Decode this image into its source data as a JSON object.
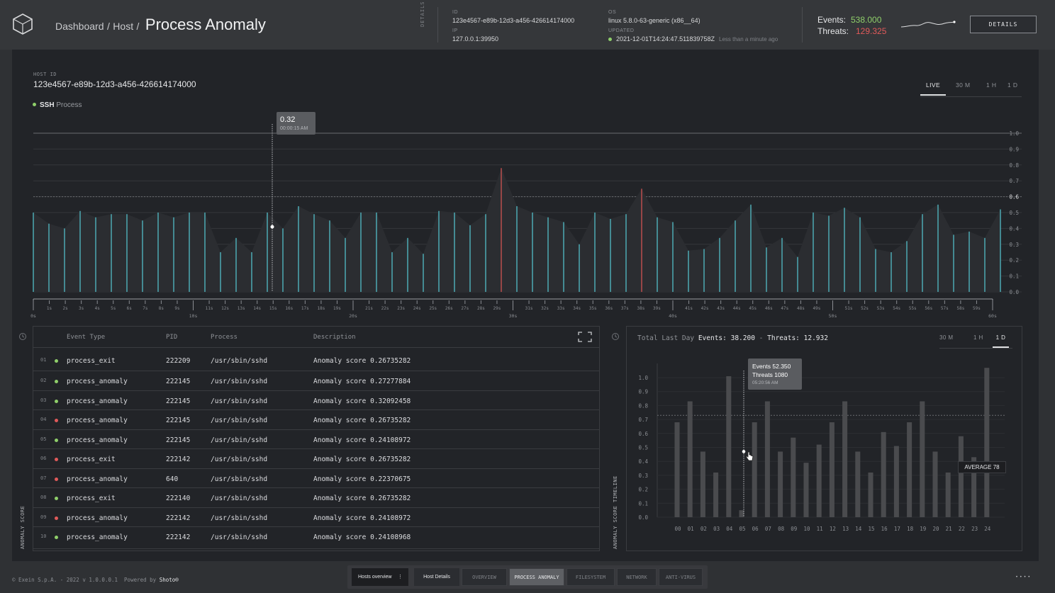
{
  "header": {
    "breadcrumb_dashboard": "Dashboard",
    "breadcrumb_sep1": "/",
    "breadcrumb_host": "Host",
    "breadcrumb_sep2": "/",
    "title": "Process Anomaly",
    "details_vertical": "DETAILS",
    "id_label": "ID",
    "id_value": "123e4567-e89b-12d3-a456-426614174000",
    "ip_label": "IP",
    "ip_value": "127.0.0.1:39950",
    "os_label": "OS",
    "os_value": "linux 5.8.0-63-generic (x86__64)",
    "updated_label": "UPDATED",
    "updated_value": "2021-12-01T14:24:47.511839758Z",
    "updated_relative": "Less than a minute ago",
    "events_label": "Events:",
    "events_value": "538.000",
    "threats_label": "Threats:",
    "threats_value": "129.325",
    "details_button": "DETAILS"
  },
  "host_panel": {
    "host_id_label": "HOST ID",
    "host_id_value": "123e4567-e89b-12d3-a456-426614174000",
    "legend_bold": "SSH",
    "legend_rest": "Process",
    "tabs": [
      "LIVE",
      "30 M",
      "1 H",
      "1 D"
    ],
    "tooltip_value": "0.32",
    "tooltip_time": "00:00:15 AM",
    "y_ticks": [
      "1.0",
      "0.9",
      "0.8",
      "0.7",
      "0.6",
      "0.5",
      "0.4",
      "0.3",
      "0.2",
      "0.1",
      "0.0"
    ]
  },
  "chart_data": [
    {
      "type": "bar",
      "title": "",
      "ylim": [
        0,
        1.0
      ],
      "threshold": 0.6,
      "x_major_labels": [
        "0s",
        "10s",
        "20s",
        "30s",
        "40s",
        "50s",
        "60s"
      ],
      "x_minor_labels": [
        "1s",
        "2s",
        "3s",
        "4s",
        "5s",
        "6s",
        "7s",
        "8s",
        "9s",
        "11s",
        "12s",
        "13s",
        "14s",
        "15s",
        "16s",
        "17s",
        "18s",
        "19s",
        "21s",
        "22s",
        "23s",
        "24s",
        "25s",
        "26s",
        "27s",
        "28s",
        "29s",
        "31s",
        "32s",
        "33s",
        "34s",
        "35s",
        "36s",
        "37s",
        "38s",
        "39s",
        "41s",
        "42s",
        "43s",
        "44s",
        "45s",
        "46s",
        "47s",
        "48s",
        "49s",
        "51s",
        "52s",
        "53s",
        "54s",
        "55s",
        "56s",
        "57s",
        "58s",
        "59s"
      ],
      "values": [
        0.5,
        0.43,
        0.4,
        0.51,
        0.47,
        0.49,
        0.49,
        0.45,
        0.5,
        0.47,
        0.5,
        0.5,
        0.25,
        0.34,
        0.25,
        0.5,
        0.4,
        0.54,
        0.49,
        0.45,
        0.34,
        0.5,
        0.5,
        0.25,
        0.34,
        0.24,
        0.51,
        0.5,
        0.42,
        0.49,
        0.78,
        0.54,
        0.5,
        0.47,
        0.44,
        0.3,
        0.5,
        0.46,
        0.49,
        0.65,
        0.47,
        0.44,
        0.26,
        0.27,
        0.34,
        0.45,
        0.55,
        0.28,
        0.34,
        0.22,
        0.5,
        0.48,
        0.53,
        0.47,
        0.27,
        0.25,
        0.32,
        0.49,
        0.55,
        0.36,
        0.38,
        0.34,
        0.52
      ],
      "anomalies": [
        30,
        39
      ]
    },
    {
      "type": "bar",
      "ylabel": "ANOMALY SCORE TIMELINE",
      "ylim": [
        0,
        1.0
      ],
      "y_ticks": [
        "1.0",
        "0.9",
        "0.8",
        "0.7",
        "0.6",
        "0.5",
        "0.4",
        "0.3",
        "0.2",
        "0.1",
        "0.0"
      ],
      "categories": [
        "00",
        "01",
        "02",
        "03",
        "04",
        "05",
        "06",
        "07",
        "08",
        "09",
        "10",
        "11",
        "12",
        "13",
        "14",
        "15",
        "16",
        "17",
        "18",
        "19",
        "20",
        "21",
        "22",
        "23",
        "24"
      ],
      "values": [
        0.68,
        0.83,
        0.47,
        0.32,
        1.01,
        0.05,
        0.68,
        0.83,
        0.47,
        0.57,
        0.39,
        0.52,
        0.68,
        0.83,
        0.47,
        0.32,
        0.61,
        0.51,
        0.68,
        0.83,
        0.47,
        0.32,
        0.58,
        0.43,
        1.07
      ],
      "average_label": "AVERAGE 78",
      "average": 0.73
    }
  ],
  "table": {
    "columns": [
      "Event Type",
      "PID",
      "Process",
      "Description"
    ],
    "rows": [
      {
        "num": "01",
        "status": "green",
        "type": "process_exit",
        "pid": "222209",
        "process": "/usr/sbin/sshd",
        "desc": "Anomaly score 0.26735282"
      },
      {
        "num": "02",
        "status": "green",
        "type": "process_anomaly",
        "pid": "222145",
        "process": "/usr/sbin/sshd",
        "desc": "Anomaly score 0.27277884"
      },
      {
        "num": "03",
        "status": "green",
        "type": "process_anomaly",
        "pid": "222145",
        "process": "/usr/sbin/sshd",
        "desc": "Anomaly score 0.32092458"
      },
      {
        "num": "04",
        "status": "red",
        "type": "process_anomaly",
        "pid": "222145",
        "process": "/usr/sbin/sshd",
        "desc": "Anomaly score 0.26735282"
      },
      {
        "num": "05",
        "status": "green",
        "type": "process_anomaly",
        "pid": "222145",
        "process": "/usr/sbin/sshd",
        "desc": "Anomaly score 0.24108972"
      },
      {
        "num": "06",
        "status": "red",
        "type": "process_exit",
        "pid": "222142",
        "process": "/usr/sbin/sshd",
        "desc": "Anomaly score 0.26735282"
      },
      {
        "num": "07",
        "status": "red",
        "type": "process_anomaly",
        "pid": "640",
        "process": "/usr/sbin/sshd",
        "desc": "Anomaly score 0.22370675"
      },
      {
        "num": "08",
        "status": "green",
        "type": "process_exit",
        "pid": "222140",
        "process": "/usr/sbin/sshd",
        "desc": "Anomaly score 0.26735282"
      },
      {
        "num": "09",
        "status": "red",
        "type": "process_anomaly",
        "pid": "222142",
        "process": "/usr/sbin/sshd",
        "desc": "Anomaly score 0.24108972"
      },
      {
        "num": "10",
        "status": "green",
        "type": "process_anomaly",
        "pid": "222142",
        "process": "/usr/sbin/sshd",
        "desc": "Anomaly score 0.24108968"
      }
    ],
    "side_label": "ANOMALY SCORE"
  },
  "right_panel": {
    "total_label": "Total Last Day",
    "events_label": "Events:",
    "events_value": "38.200",
    "sep": "-",
    "threats_label": "Threats:",
    "threats_value": "12.932",
    "tabs": [
      "30 M",
      "1 H",
      "1 D"
    ],
    "tooltip_events_label": "Events",
    "tooltip_events_value": "52.350",
    "tooltip_threats_label": "Threats",
    "tooltip_threats_value": "1080",
    "tooltip_time": "05:20:56 AM"
  },
  "footer": {
    "copyright": "© Exein S.p.A. - 2022 v 1.0.0.0.1",
    "powered": "Powered by",
    "brand": "Shoto®",
    "hosts_overview": "Hosts overview",
    "host_details": "Host Details",
    "nav": [
      "OVERVIEW",
      "PROCESS ANOMALY",
      "FILESYSTEM",
      "NETWORK",
      "ANTI-VIRUS"
    ],
    "dots": "• • • •"
  },
  "colors": {
    "green": "#8fcf6a",
    "red": "#e05a5a",
    "teal": "#4fb3bd",
    "anomaly": "#c55050"
  }
}
